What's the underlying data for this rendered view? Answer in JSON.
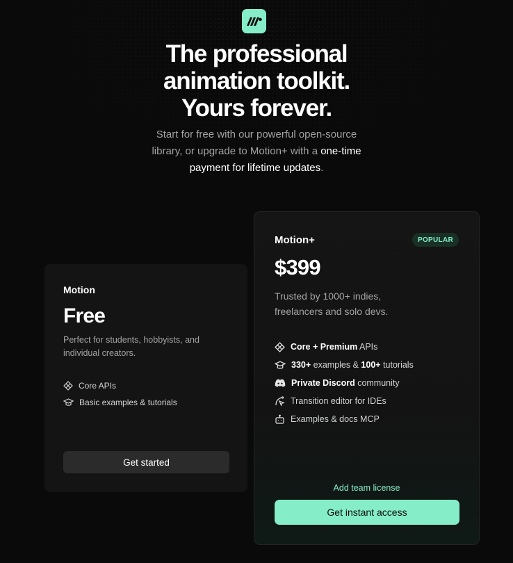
{
  "hero": {
    "title_lines": [
      "The professional",
      "animation toolkit.",
      "Yours forever."
    ],
    "subtitle_part1": "Start for free with our powerful open-source library, or upgrade to Motion+ with a ",
    "subtitle_highlight": "one-time payment for lifetime updates",
    "subtitle_part2": "."
  },
  "colors": {
    "accent": "#85edc8",
    "background": "#0a0a0a",
    "card": "#141414"
  },
  "free_plan": {
    "name": "Motion",
    "price": "Free",
    "description": "Perfect for students, hobbyists, and individual creators.",
    "features": [
      {
        "icon": "diamond-grid-icon",
        "text": "Core APIs"
      },
      {
        "icon": "graduation-cap-icon",
        "text": "Basic examples & tutorials"
      }
    ],
    "button_label": "Get started"
  },
  "plus_plan": {
    "name": "Motion+",
    "badge": "POPULAR",
    "price": "$399",
    "description": "Trusted by 1000+ indies, freelancers and solo devs.",
    "features": [
      {
        "icon": "diamond-grid-icon",
        "bold": "Core + Premium",
        "text": " APIs"
      },
      {
        "icon": "graduation-cap-icon",
        "bold": "330+",
        "text": " examples & ",
        "bold2": "100+",
        "text2": " tutorials"
      },
      {
        "icon": "discord-icon",
        "bold": "Private Discord",
        "text": " community"
      },
      {
        "icon": "cursor-path-icon",
        "bold": "",
        "text": "Transition editor for IDEs"
      },
      {
        "icon": "robot-icon",
        "bold": "",
        "text": "Examples & docs MCP"
      }
    ],
    "team_link": "Add team license",
    "button_label": "Get instant access"
  }
}
